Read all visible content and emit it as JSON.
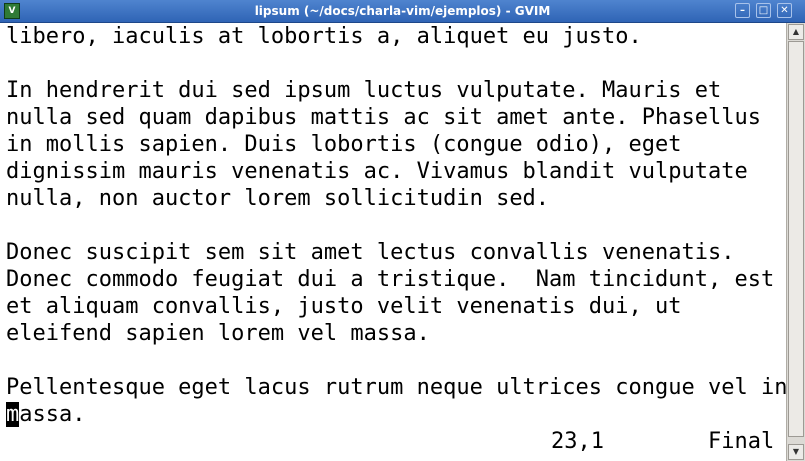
{
  "window": {
    "title": "lipsum (~/docs/charla-vim/ejemplos) - GVIM",
    "icon_label": "V",
    "minimize_glyph": "–",
    "maximize_glyph": "□",
    "close_glyph": "✕"
  },
  "editor": {
    "lines": [
      "libero, iaculis at lobortis a, aliquet eu justo.",
      "",
      "In hendrerit dui sed ipsum luctus vulputate. Mauris et",
      "nulla sed quam dapibus mattis ac sit amet ante. Phasellus",
      "in mollis sapien. Duis lobortis (congue odio), eget",
      "dignissim mauris venenatis ac. Vivamus blandit vulputate",
      "nulla, non auctor lorem sollicitudin sed.",
      "",
      "Donec suscipit sem sit amet lectus convallis venenatis.",
      "Donec commodo feugiat dui a tristique.  Nam tincidunt, est",
      "et aliquam convallis, justo velit venenatis dui, ut",
      "eleifend sapien lorem vel massa.",
      "",
      "Pellentesque eget lacus rutrum neque ultrices congue vel in"
    ],
    "cursor_char": "m",
    "cursor_line_rest": "assa."
  },
  "ruler": {
    "position": "23,1",
    "scroll": "Final"
  },
  "scrollbar": {
    "up_glyph": "▲",
    "down_glyph": "▼"
  }
}
